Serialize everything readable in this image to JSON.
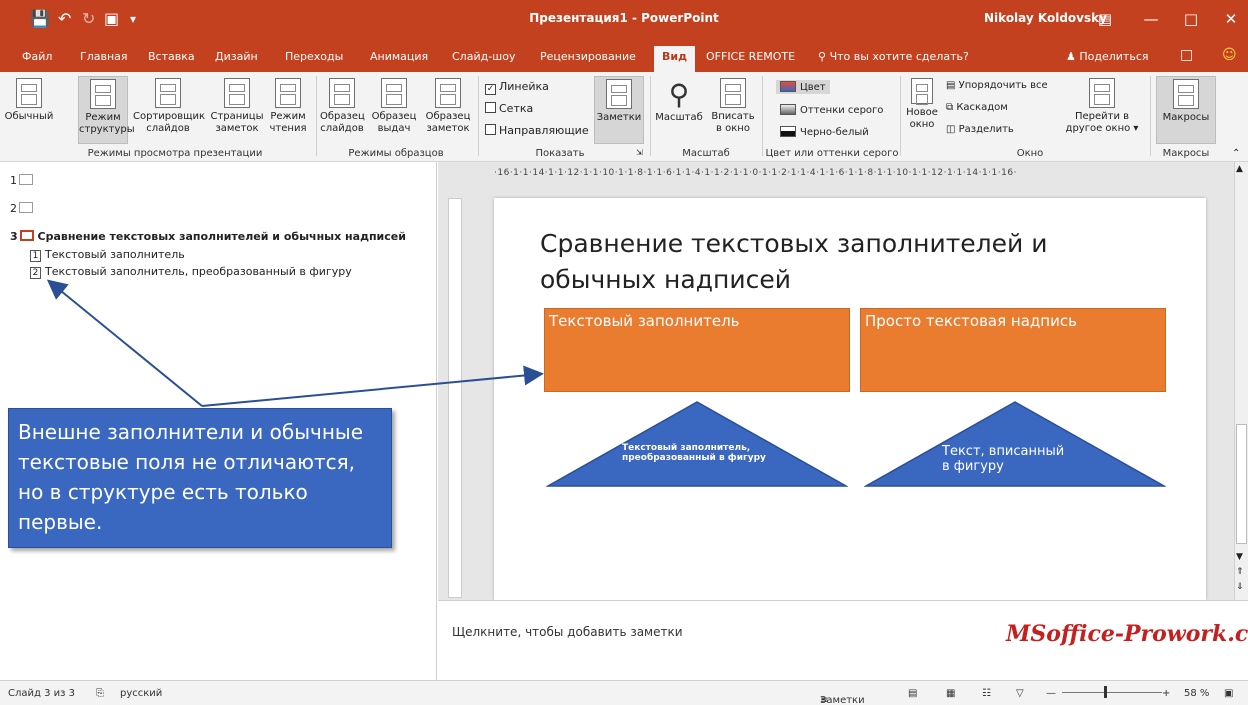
{
  "window": {
    "title": "Презентация1 - PowerPoint",
    "user": "Nikolay Koldovsky"
  },
  "tabs": [
    "Файл",
    "Главная",
    "Вставка",
    "Дизайн",
    "Переходы",
    "Анимация",
    "Слайд-шоу",
    "Рецензирование",
    "Вид",
    "OFFICE REMOTE"
  ],
  "active_tab": "Вид",
  "tell_me": "Что вы хотите сделать?",
  "share": "Поделиться",
  "ribbon": {
    "views": {
      "normal": "Обычный",
      "outline": [
        "Режим",
        "структуры"
      ],
      "sorter": [
        "Сортировщик",
        "слайдов"
      ],
      "notes_page": [
        "Страницы",
        "заметок"
      ],
      "reading": [
        "Режим",
        "чтения"
      ],
      "group": "Режимы просмотра презентации"
    },
    "masters": {
      "slide_master": [
        "Образец",
        "слайдов"
      ],
      "handout_master": [
        "Образец",
        "выдач"
      ],
      "notes_master": [
        "Образец",
        "заметок"
      ],
      "group": "Режимы образцов"
    },
    "show": {
      "ruler": "Линейка",
      "gridlines": "Сетка",
      "guides": "Направляющие",
      "notes": "Заметки",
      "group": "Показать"
    },
    "zoom": {
      "zoom": "Масштаб",
      "fit": [
        "Вписать",
        "в окно"
      ],
      "group": "Масштаб"
    },
    "color": {
      "color": "Цвет",
      "grayscale": "Оттенки серого",
      "bw": "Черно-белый",
      "group": "Цвет или оттенки серого"
    },
    "window": {
      "new": [
        "Новое",
        "окно"
      ],
      "arrange": "Упорядочить все",
      "cascade": "Каскадом",
      "split": "Разделить",
      "switch": [
        "Перейти в",
        "другое окно"
      ],
      "group": "Окно"
    },
    "macros": {
      "macros": "Макросы",
      "group": "Макросы"
    }
  },
  "outline": {
    "slide1": "1",
    "slide2": "2",
    "slide3_num": "3",
    "slide3_title": "Сравнение текстовых заполнителей и обычных надписей",
    "item1_num": "1",
    "item1": "Текстовый заполнитель",
    "item2_num": "2",
    "item2": "Текстовый заполнитель, преобразованный в фигуру"
  },
  "callout": [
    "Внешне заполнители и обычные",
    "текстовые поля не отличаются,",
    "но в структуре есть только",
    "первые."
  ],
  "ruler_text": "·16·1·1·14·1·1·12·1·1·10·1·1·8·1·1·6·1·1·4·1·1·2·1·1·0·1·1·2·1·1·4·1·1·6·1·1·8·1·1·10·1·1·12·1·1·14·1·1·16·",
  "slide": {
    "title": "Сравнение текстовых заполнителей и обычных надписей",
    "box1": "Текстовый заполнитель",
    "box2": "Просто текстовая надпись",
    "tri1": "Текстовый заполнитель, преобразованный в фигуру",
    "tri2": "Текст, вписанный в фигуру"
  },
  "notes_placeholder": "Щелкните, чтобы добавить заметки",
  "watermark": "MSoffice-Prowork.com",
  "status": {
    "slide": "Слайд 3 из 3",
    "lang": "русский",
    "notes": "Заметки",
    "zoom": "58 %"
  },
  "colors": {
    "accent": "#c4411f",
    "orange": "#ea7c2f",
    "blue": "#3a68c0"
  }
}
